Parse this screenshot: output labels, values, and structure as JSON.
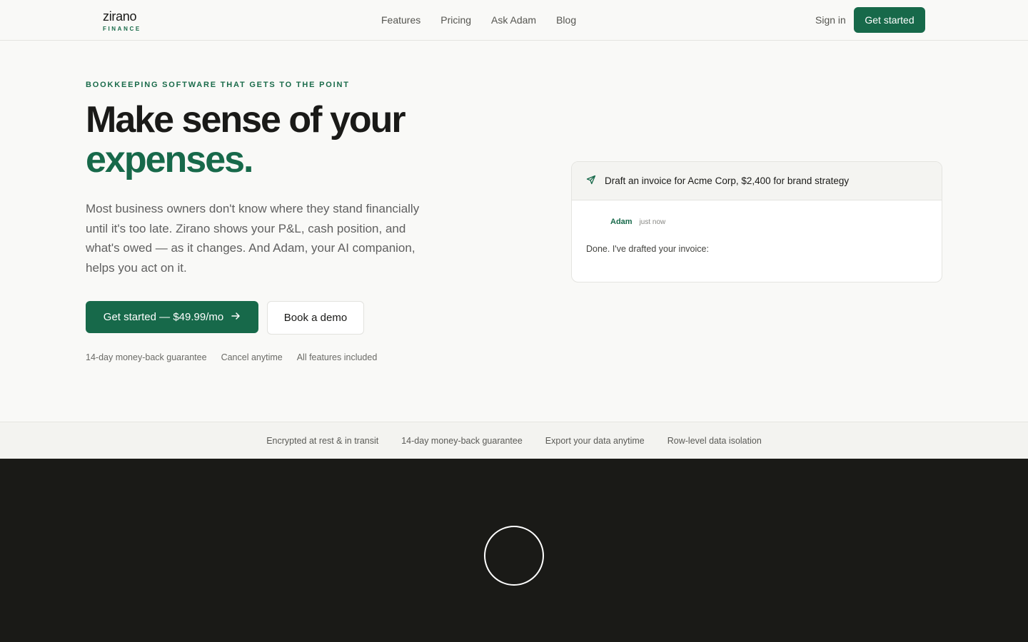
{
  "header": {
    "logo_word": "zirano",
    "logo_sub": "FINANCE",
    "nav": [
      "Features",
      "Pricing",
      "Ask Adam",
      "Blog"
    ],
    "signin": "Sign in",
    "cta": "Get started"
  },
  "hero": {
    "eyebrow": "BOOKKEEPING SOFTWARE THAT GETS TO THE POINT",
    "headline_1": "Make sense of your",
    "headline_2": "expenses.",
    "lede": "Most business owners don't know where they stand financially until it's too late. Zirano shows your P&L, cash position, and what's owed — as it changes. And Adam, your AI companion, helps you act on it.",
    "primary_cta": "Get started — $49.99/mo",
    "secondary_cta": "Book a demo",
    "perks": [
      "14-day money-back guarantee",
      "Cancel anytime",
      "All features included"
    ]
  },
  "chat": {
    "prompt": "Draft an invoice for Acme Corp, $2,400 for brand strategy",
    "sender": "Adam",
    "time": "just now",
    "message": "Done. I've drafted your invoice:"
  },
  "trust": [
    "Encrypted at rest & in transit",
    "14-day money-back guarantee",
    "Export your data anytime",
    "Row-level data isolation"
  ],
  "colors": {
    "accent": "#17694a",
    "dark": "#1a1a17",
    "background": "#f9f9f7"
  },
  "icons": {
    "prompt": "send-icon",
    "cta": "arrow-right-icon",
    "video": "play-icon"
  }
}
